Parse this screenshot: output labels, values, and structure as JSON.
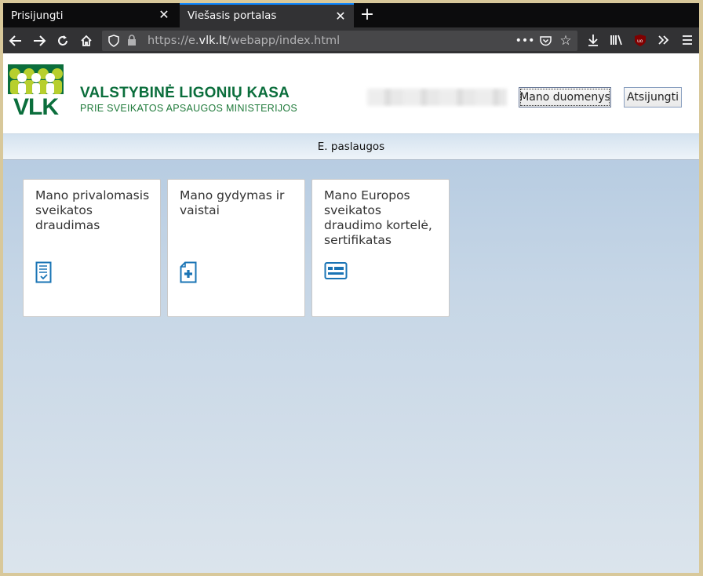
{
  "browser": {
    "tabs": [
      {
        "label": "Prisijungti",
        "active": false
      },
      {
        "label": "Viešasis portalas",
        "active": true
      }
    ],
    "url": {
      "prefix": "https://e.",
      "domain": "vlk.lt",
      "path": "/webapp/index.html"
    }
  },
  "header": {
    "logo_text": "VLK",
    "title": "VALSTYBINĖ LIGONIŲ KASA",
    "subtitle": "PRIE SVEIKATOS APSAUGOS MINISTERIJOS",
    "my_data_label": "Mano duomenys",
    "logout_label": "Atsijungti"
  },
  "nav": {
    "label": "E. paslaugos"
  },
  "cards": [
    {
      "title": "Mano privalomasis sveikatos draudimas",
      "icon": "checklist-document-icon"
    },
    {
      "title": "Mano gydymas ir vaistai",
      "icon": "medical-document-icon"
    },
    {
      "title": "Mano Europos sveikatos draudimo kortelė, sertifikatas",
      "icon": "card-icon"
    }
  ],
  "colors": {
    "brand_green": "#0b6e3c",
    "accent_lime": "#b7cf2e",
    "icon_blue": "#1a74b5",
    "tab_accent": "#0a84ff"
  }
}
